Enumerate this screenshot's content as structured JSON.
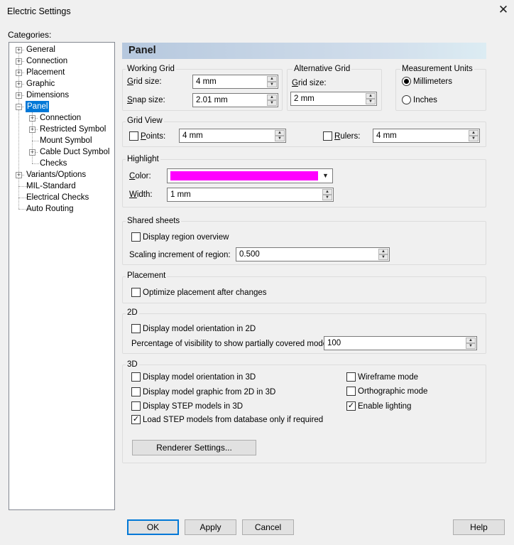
{
  "window": {
    "title": "Electric Settings",
    "close_label": "✕"
  },
  "categories": {
    "label": "Categories:",
    "items": [
      {
        "label": "General"
      },
      {
        "label": "Connection"
      },
      {
        "label": "Placement"
      },
      {
        "label": "Graphic"
      },
      {
        "label": "Dimensions"
      },
      {
        "label": "Panel"
      },
      {
        "label": "Connection"
      },
      {
        "label": "Restricted Symbol"
      },
      {
        "label": "Mount Symbol"
      },
      {
        "label": "Cable Duct Symbol"
      },
      {
        "label": "Checks"
      },
      {
        "label": "Variants/Options"
      },
      {
        "label": "MIL-Standard"
      },
      {
        "label": "Electrical Checks"
      },
      {
        "label": "Auto Routing"
      }
    ]
  },
  "panel": {
    "title": "Panel"
  },
  "working_grid": {
    "label": "Working Grid",
    "grid_size_label": "Grid size:",
    "grid_size_value": "4 mm",
    "snap_size_label": "Snap size:",
    "snap_size_value": "2.01 mm"
  },
  "alternative_grid": {
    "label": "Alternative Grid",
    "grid_size_label": "Grid size:",
    "grid_size_value": "2 mm"
  },
  "measurement_units": {
    "label": "Measurement Units",
    "millimeters": "Millimeters",
    "inches": "Inches"
  },
  "grid_view": {
    "label": "Grid View",
    "points_label": "Points:",
    "points_value": "4 mm",
    "rulers_label": "Rulers:",
    "rulers_value": "4 mm"
  },
  "highlight": {
    "label": "Highlight",
    "color_label": "Color:",
    "color_value": "#ff00ff",
    "width_label": "Width:",
    "width_value": "1 mm"
  },
  "shared_sheets": {
    "label": "Shared sheets",
    "display_region_overview": "Display region overview",
    "scaling_label": "Scaling increment of region:",
    "scaling_value": "0.500"
  },
  "placement": {
    "label": "Placement",
    "optimize": "Optimize placement after changes"
  },
  "two_d": {
    "label": "2D",
    "display_orientation": "Display model orientation in 2D",
    "visibility_label": "Percentage of visibility to show partially covered models:",
    "visibility_value": "100"
  },
  "three_d": {
    "label": "3D",
    "display_orientation": "Display model orientation in 3D",
    "display_graphic": "Display model graphic from 2D in 3D",
    "display_step": "Display STEP models in 3D",
    "load_step": "Load STEP models from database only if required",
    "wireframe": "Wireframe mode",
    "orthographic": "Orthographic mode",
    "lighting": "Enable lighting",
    "renderer_button": "Renderer Settings..."
  },
  "footer": {
    "ok": "OK",
    "apply": "Apply",
    "cancel": "Cancel",
    "help": "Help"
  }
}
